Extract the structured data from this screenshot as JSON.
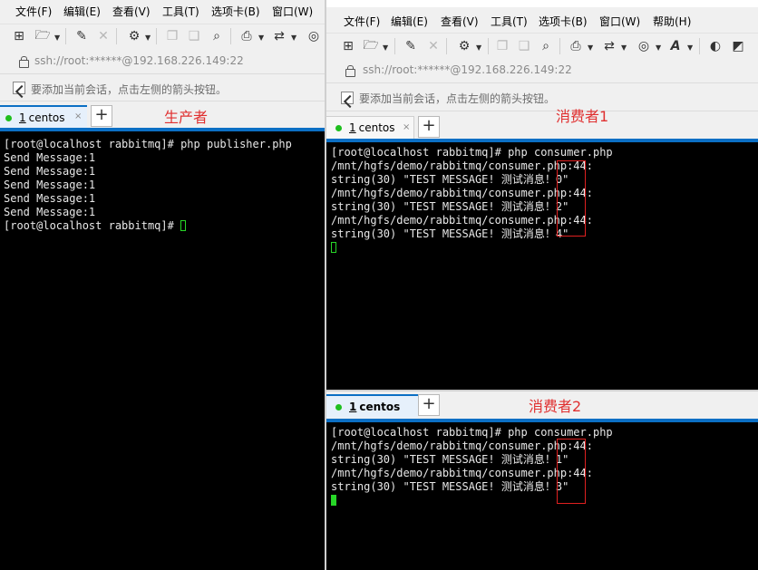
{
  "menu": [
    "文件(F)",
    "编辑(E)",
    "查看(V)",
    "工具(T)",
    "选项卡(B)",
    "窗口(W)",
    "帮助(H)"
  ],
  "address": "ssh://root:******@192.168.226.149:22",
  "hint": "要添加当前会话，点击左侧的箭头按钮。",
  "tab_num": "1",
  "tab_label": "centos",
  "plus": "+",
  "close": "×",
  "colors": {
    "accent": "#0b6fc4",
    "caption": "#e03030",
    "cursor": "#27d627",
    "redbox": "#e02020"
  },
  "icons": [
    "new-session-icon",
    "open-folder-icon",
    "connect-icon",
    "disconnect-icon",
    "properties-icon",
    "copy-icon",
    "paste-icon",
    "find-icon",
    "print-icon",
    "transfer-icon",
    "globe-icon",
    "font-icon",
    "xftp-icon",
    "xmanager-icon"
  ],
  "panes": {
    "producer": {
      "caption": "生产者",
      "lines": [
        "[root@localhost rabbitmq]# php publisher.php",
        "Send Message:1",
        "Send Message:1",
        "Send Message:1",
        "Send Message:1",
        "Send Message:1",
        "[root@localhost rabbitmq]# "
      ]
    },
    "consumer1": {
      "caption": "消费者1",
      "lines": [
        "[root@localhost rabbitmq]# php consumer.php",
        "/mnt/hgfs/demo/rabbitmq/consumer.php:44:",
        "string(30) \"TEST MESSAGE! 测试消息！0\"",
        "/mnt/hgfs/demo/rabbitmq/consumer.php:44:",
        "string(30) \"TEST MESSAGE! 测试消息！2\"",
        "/mnt/hgfs/demo/rabbitmq/consumer.php:44:",
        "string(30) \"TEST MESSAGE! 测试消息！4\""
      ]
    },
    "consumer2": {
      "caption": "消费者2",
      "lines": [
        "[root@localhost rabbitmq]# php consumer.php",
        "/mnt/hgfs/demo/rabbitmq/consumer.php:44:",
        "string(30) \"TEST MESSAGE! 测试消息！1\"",
        "/mnt/hgfs/demo/rabbitmq/consumer.php:44:",
        "string(30) \"TEST MESSAGE! 测试消息！3\""
      ]
    }
  }
}
